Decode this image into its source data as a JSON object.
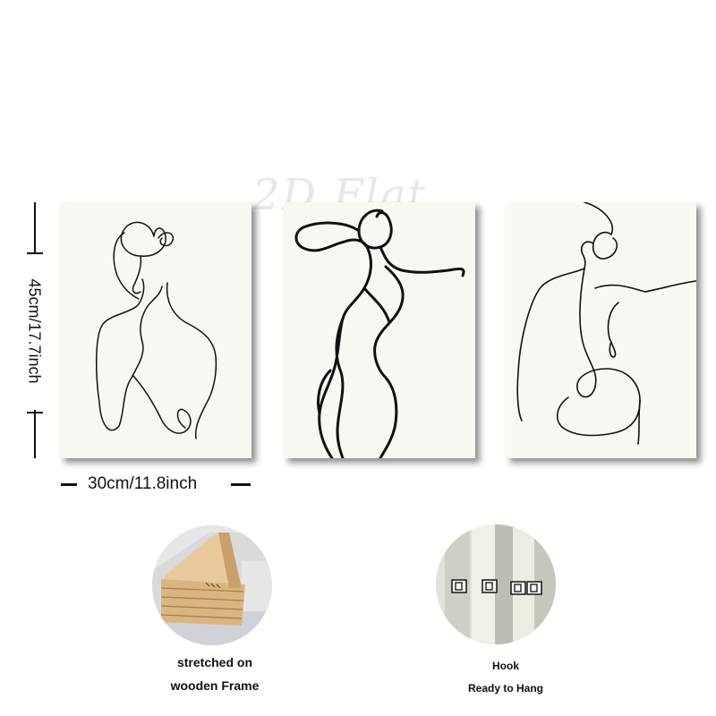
{
  "watermark": "2D Flat",
  "dimensions": {
    "height_label": "45cm/17.7inch",
    "width_label": "30cm/11.8inch"
  },
  "artworks": [
    {
      "name": "woman-back-line-art",
      "icon": "woman-back-line-drawing"
    },
    {
      "name": "woman-figure-line-art",
      "icon": "woman-figure-line-drawing"
    },
    {
      "name": "woman-seated-line-art",
      "icon": "woman-seated-line-drawing"
    }
  ],
  "features": [
    {
      "line1": "stretched on",
      "line2": "wooden Frame",
      "icon": "wooden-frame-corner-photo"
    },
    {
      "line1": "Hook",
      "line2": "Ready to Hang",
      "icon": "hanging-hooks-photo"
    }
  ],
  "colors": {
    "canvas": "#f9f7f2",
    "line_art": "#111111",
    "wood": "#d8b88e"
  }
}
